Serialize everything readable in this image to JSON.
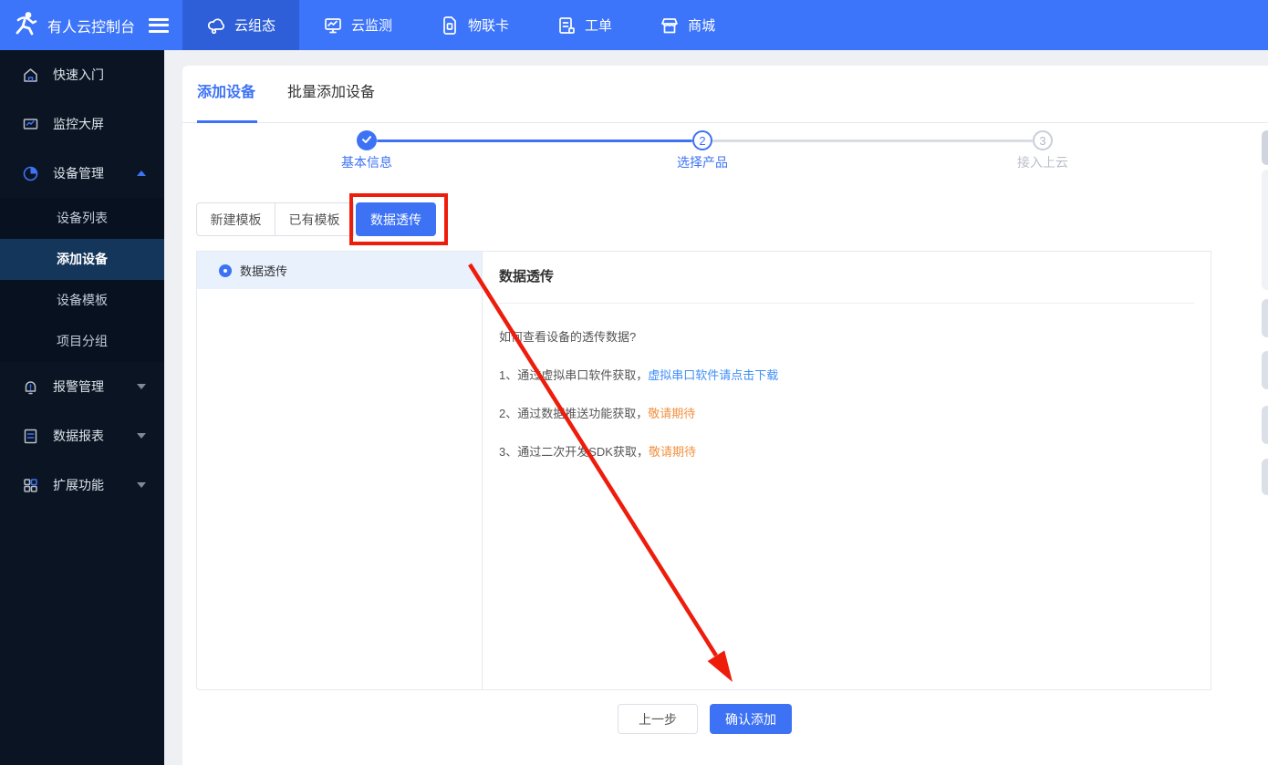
{
  "topbar": {
    "logo_text": "有人云控制台",
    "nav": [
      {
        "label": "云组态",
        "active": true
      },
      {
        "label": "云监测",
        "active": false
      },
      {
        "label": "物联卡",
        "active": false
      },
      {
        "label": "工单",
        "active": false
      },
      {
        "label": "商城",
        "active": false
      }
    ]
  },
  "sidebar": {
    "items": [
      {
        "label": "快速入门"
      },
      {
        "label": "监控大屏"
      },
      {
        "label": "设备管理",
        "expanded": true
      },
      {
        "label": "报警管理"
      },
      {
        "label": "数据报表"
      },
      {
        "label": "扩展功能"
      }
    ],
    "submenu": [
      {
        "label": "设备列表"
      },
      {
        "label": "添加设备",
        "active": true
      },
      {
        "label": "设备模板"
      },
      {
        "label": "项目分组"
      }
    ]
  },
  "main": {
    "tabs": [
      {
        "label": "添加设备",
        "active": true
      },
      {
        "label": "批量添加设备",
        "active": false
      }
    ],
    "stepper": [
      {
        "num": "1",
        "label": "基本信息",
        "state": "done"
      },
      {
        "num": "2",
        "label": "选择产品",
        "state": "active"
      },
      {
        "num": "3",
        "label": "接入上云",
        "state": "pending"
      }
    ],
    "template_tabs": [
      {
        "label": "新建模板",
        "active": false
      },
      {
        "label": "已有模板",
        "active": false
      },
      {
        "label": "数据透传",
        "active": true
      }
    ],
    "list_panel": {
      "selected_item": "数据透传"
    },
    "detail": {
      "title": "数据透传",
      "question": "如何查看设备的透传数据?",
      "items": [
        {
          "text": "1、通过虚拟串口软件获取，",
          "extra": "虚拟串口软件请点击下载",
          "extra_type": "link"
        },
        {
          "text": "2、通过数据推送功能获取，",
          "extra": "敬请期待",
          "extra_type": "pending"
        },
        {
          "text": "3、通过二次开发SDK获取，",
          "extra": "敬请期待",
          "extra_type": "pending"
        }
      ]
    },
    "footer": {
      "prev": "上一步",
      "confirm": "确认添加"
    }
  },
  "colors": {
    "topbar": "#3c74fa",
    "topbar_active": "#2e5fd9",
    "primary": "#3d72f5",
    "link": "#3e8ef7",
    "pending_orange": "#f2913f",
    "annotation_red": "#ee1c0b",
    "sidebar_bg": "#0a1422",
    "sidebar_active_bg": "#14365b",
    "selected_row_bg": "#e9f1fd"
  }
}
